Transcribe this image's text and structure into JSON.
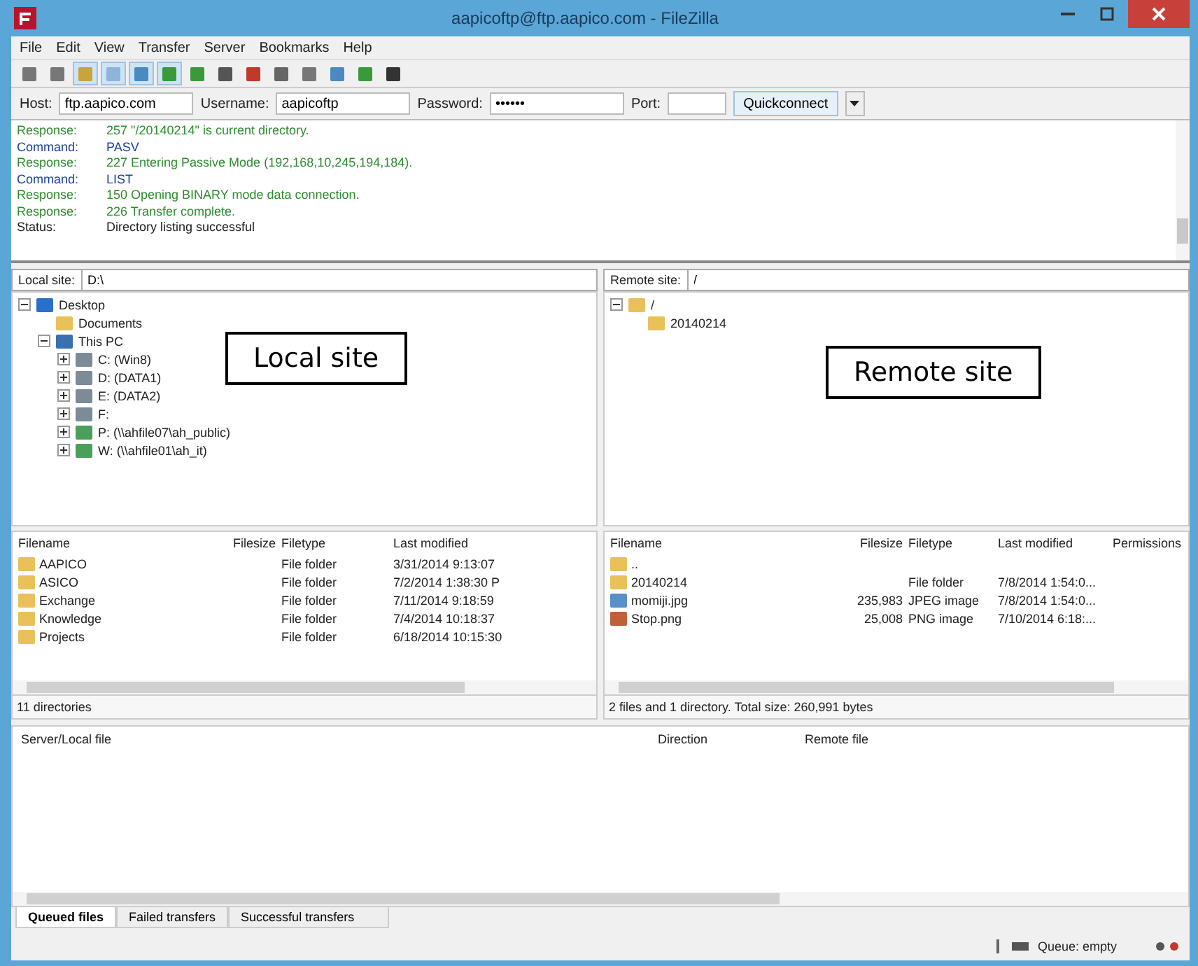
{
  "window": {
    "title": "aapicoftp@ftp.aapico.com - FileZilla"
  },
  "menu": [
    "File",
    "Edit",
    "View",
    "Transfer",
    "Server",
    "Bookmarks",
    "Help"
  ],
  "quickconnect": {
    "host_label": "Host:",
    "host": "ftp.aapico.com",
    "username_label": "Username:",
    "username": "aapicoftp",
    "password_label": "Password:",
    "password": "••••••",
    "port_label": "Port:",
    "button": "Quickconnect"
  },
  "log": [
    {
      "kind": "response",
      "label": "Response:",
      "message": "257 \"/20140214\" is current directory."
    },
    {
      "kind": "command",
      "label": "Command:",
      "message": "PASV"
    },
    {
      "kind": "response",
      "label": "Response:",
      "message": "227 Entering Passive Mode (192,168,10,245,194,184)."
    },
    {
      "kind": "command",
      "label": "Command:",
      "message": "LIST"
    },
    {
      "kind": "response",
      "label": "Response:",
      "message": "150 Opening BINARY mode data connection."
    },
    {
      "kind": "response",
      "label": "Response:",
      "message": "226 Transfer complete."
    },
    {
      "kind": "status",
      "label": "Status:",
      "message": "Directory listing successful"
    }
  ],
  "local_site": {
    "label": "Local site:",
    "path": "D:\\"
  },
  "remote_site": {
    "label": "Remote site:",
    "path": "/"
  },
  "local_tree": [
    {
      "name": "Desktop",
      "kind": "desktop",
      "expanded": true,
      "children": [
        {
          "name": "Documents",
          "kind": "folder"
        },
        {
          "name": "This PC",
          "kind": "pc",
          "expanded": true,
          "children": [
            {
              "name": "C: (Win8)",
              "kind": "drive",
              "expanded": false
            },
            {
              "name": "D: (DATA1)",
              "kind": "drive",
              "expanded": false
            },
            {
              "name": "E: (DATA2)",
              "kind": "drive",
              "expanded": false
            },
            {
              "name": "F:",
              "kind": "drive",
              "expanded": false
            },
            {
              "name": "P: (\\\\ahfile07\\ah_public)",
              "kind": "network",
              "expanded": false
            },
            {
              "name": "W: (\\\\ahfile01\\ah_it)",
              "kind": "network",
              "expanded": false
            }
          ]
        }
      ]
    }
  ],
  "remote_tree": [
    {
      "name": "/",
      "kind": "folder",
      "expanded": true,
      "children": [
        {
          "name": "20140214",
          "kind": "folder"
        }
      ]
    }
  ],
  "annotations": [
    "Local site",
    "Remote site"
  ],
  "local_files": {
    "columns": [
      "Filename",
      "Filesize",
      "Filetype",
      "Last modified"
    ],
    "rows": [
      {
        "kind": "folder",
        "name": "AAPICO",
        "size": "",
        "type": "File folder",
        "modified": "3/31/2014 9:13:07"
      },
      {
        "kind": "folder",
        "name": "ASICO",
        "size": "",
        "type": "File folder",
        "modified": "7/2/2014 1:38:30 P"
      },
      {
        "kind": "folder",
        "name": "Exchange",
        "size": "",
        "type": "File folder",
        "modified": "7/11/2014 9:18:59"
      },
      {
        "kind": "folder",
        "name": "Knowledge",
        "size": "",
        "type": "File folder",
        "modified": "7/4/2014 10:18:37"
      },
      {
        "kind": "folder",
        "name": "Projects",
        "size": "",
        "type": "File folder",
        "modified": "6/18/2014 10:15:30"
      }
    ],
    "status": "11 directories"
  },
  "remote_files": {
    "columns": [
      "Filename",
      "Filesize",
      "Filetype",
      "Last modified",
      "Permissions"
    ],
    "rows": [
      {
        "kind": "folder",
        "name": "..",
        "size": "",
        "type": "",
        "modified": ""
      },
      {
        "kind": "folder",
        "name": "20140214",
        "size": "",
        "type": "File folder",
        "modified": "7/8/2014 1:54:0..."
      },
      {
        "kind": "photo",
        "name": "momiji.jpg",
        "size": "235,983",
        "type": "JPEG image",
        "modified": "7/8/2014 1:54:0..."
      },
      {
        "kind": "picture",
        "name": "Stop.png",
        "size": "25,008",
        "type": "PNG image",
        "modified": "7/10/2014 6:18:..."
      }
    ],
    "status": "2 files and 1 directory. Total size: 260,991 bytes"
  },
  "queue": {
    "columns": [
      "Server/Local file",
      "Direction",
      "Remote file"
    ]
  },
  "queue_tabs": [
    {
      "label": "Queued files",
      "selected": true
    },
    {
      "label": "Failed transfers",
      "selected": false
    },
    {
      "label": "Successful transfers",
      "selected": false
    }
  ],
  "status_bar": {
    "queue": "Queue: empty"
  }
}
